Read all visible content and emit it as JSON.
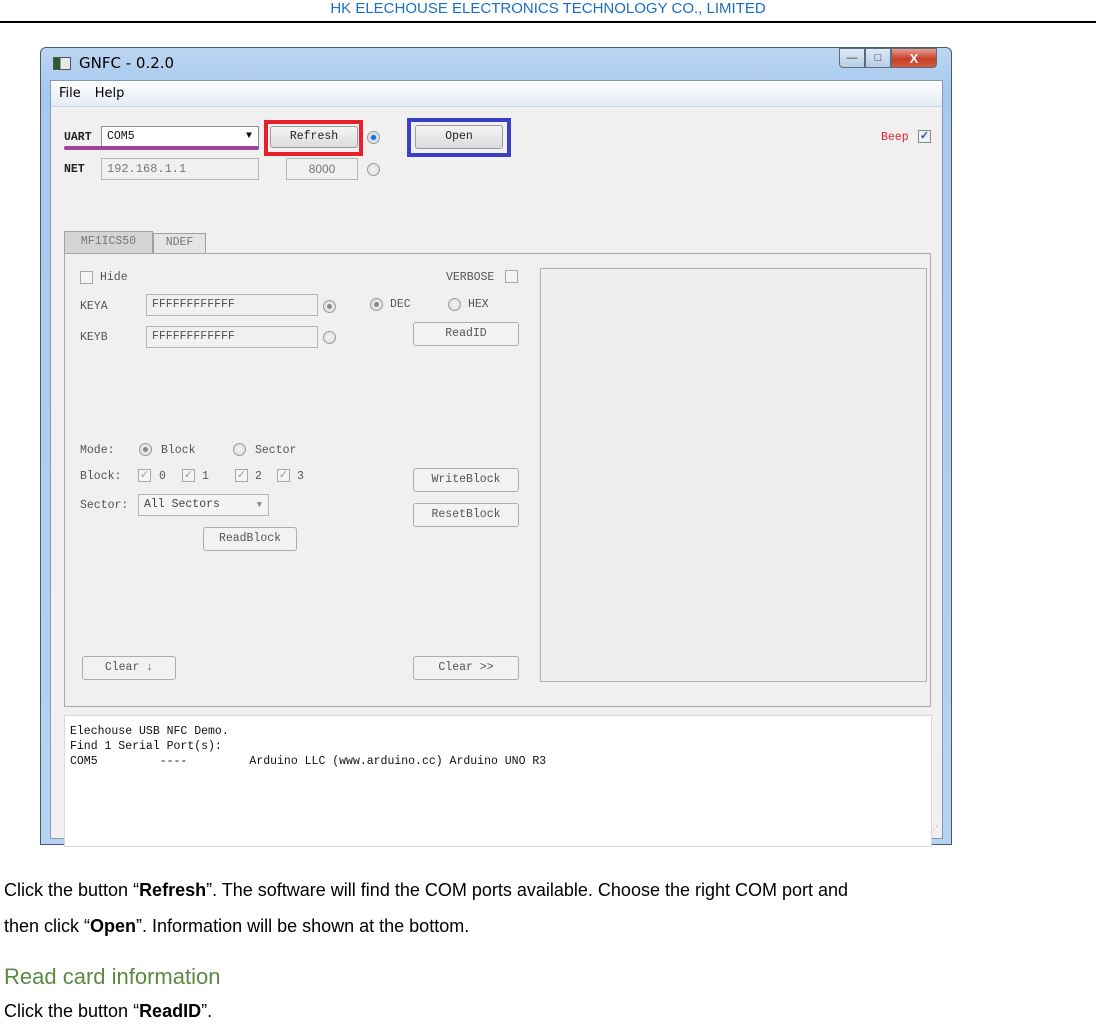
{
  "doc": {
    "header": "HK ELECHOUSE ELECTRONICS TECHNOLOGY CO., LIMITED",
    "para1": {
      "pre": "Click the button “",
      "bold1": "Refresh",
      "mid": "”. The software will find the COM ports available. Choose the right COM port and",
      "line2_pre": "then click “",
      "bold2": "Open",
      "line2_post": "”. Information will be shown at the bottom."
    },
    "section_title": "Read card information",
    "para2": {
      "pre": "Click the button “",
      "bold": "ReadID",
      "post": "”."
    },
    "highlight_colors": {
      "refresh": "#e8202a",
      "open": "#3a3fc7",
      "uart_underline": "#a0429c"
    }
  },
  "window": {
    "title": "GNFC - 0.2.0",
    "controls": {
      "minimize": "—",
      "maximize": "□",
      "close": "X"
    },
    "menu": [
      "File",
      "Help"
    ],
    "connection": {
      "uart_label": "UART",
      "uart_value": "COM5",
      "refresh": "Refresh",
      "open": "Open",
      "net_label": "NET",
      "net_ip": "192.168.1.1",
      "net_port": "8000",
      "beep_label": "Beep",
      "beep_checked": true,
      "uart_selected": true
    },
    "tabs": [
      "MF1ICS50",
      "NDEF"
    ],
    "panel": {
      "hide_label": "Hide",
      "verbose_label": "VERBOSE",
      "keya_label": "KEYA",
      "keya_value": "FFFFFFFFFFFF",
      "keyb_label": "KEYB",
      "keyb_value": "FFFFFFFFFFFF",
      "dec_label": "DEC",
      "hex_label": "HEX",
      "readid": "ReadID",
      "mode_label": "Mode:",
      "mode_block": "Block",
      "mode_sector": "Sector",
      "block_label": "Block:",
      "blocks": [
        "0",
        "1",
        "2",
        "3"
      ],
      "sector_label": "Sector:",
      "sector_value": "All Sectors",
      "readblock": "ReadBlock",
      "writeblock": "WriteBlock",
      "resetblock": "ResetBlock",
      "clear_down": "Clear ↓",
      "clear_right": "Clear >>"
    },
    "log": [
      "Elechouse USB NFC Demo.",
      "Find 1 Serial Port(s):",
      "COM5         ----         Arduino LLC (www.arduino.cc) Arduino UNO R3"
    ]
  }
}
